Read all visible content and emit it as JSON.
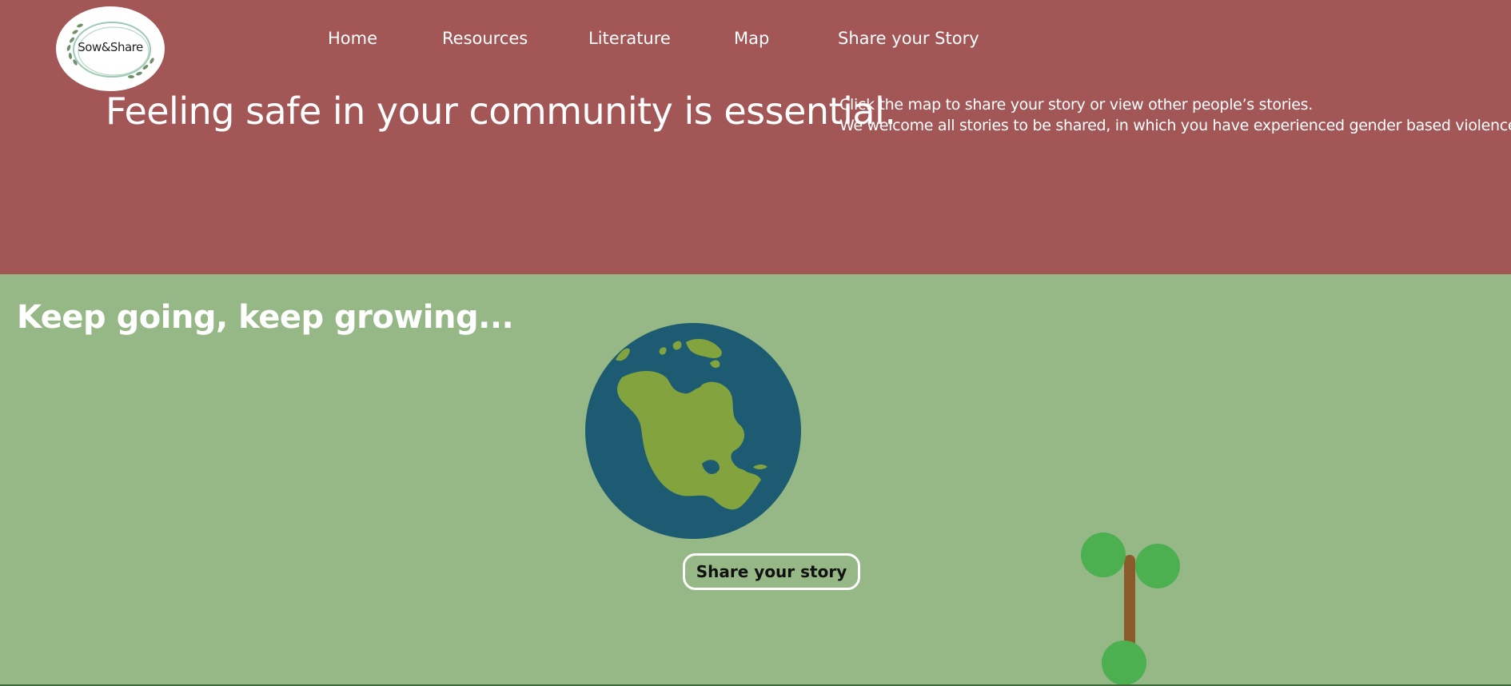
{
  "header": {
    "logo_text": "Sow&Share",
    "nav": [
      {
        "label": "Home"
      },
      {
        "label": "Resources"
      },
      {
        "label": "Literature"
      },
      {
        "label": "Map"
      },
      {
        "label": "Share your Story"
      }
    ]
  },
  "hero": {
    "headline": "Feeling safe in your community is essential.",
    "intro_line1": "Click the map to share your story or view other people’s stories.",
    "intro_line2": "We welcome all stories to be shared, in which you have experienced gender based violence."
  },
  "growth": {
    "tagline": "Keep going, keep growing...",
    "share_button_label": "Share your story",
    "globe_icon": "globe-americas-icon",
    "sprout_icon": "sprout-icon"
  },
  "colors": {
    "header_bg": "#a25656",
    "body_bg": "#96b886",
    "ocean": "#1c5b71",
    "land": "#82a33d",
    "leaf": "#4caf50",
    "stem": "#8b5a2b"
  }
}
